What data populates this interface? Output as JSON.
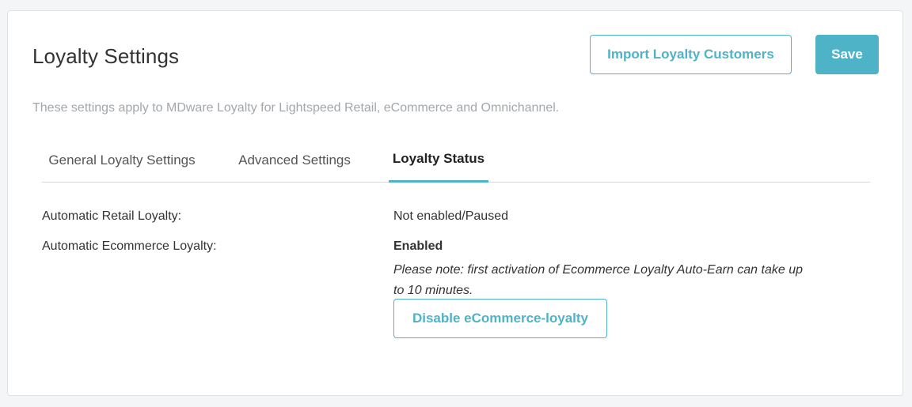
{
  "header": {
    "title": "Loyalty Settings",
    "import_label": "Import Loyalty Customers",
    "save_label": "Save"
  },
  "subtitle": "These settings apply to MDware Loyalty for Lightspeed Retail, eCommerce and Omnichannel.",
  "tabs": [
    {
      "label": "General Loyalty Settings",
      "active": false
    },
    {
      "label": "Advanced Settings",
      "active": false
    },
    {
      "label": "Loyalty Status",
      "active": true
    }
  ],
  "status": {
    "retail": {
      "label": "Automatic Retail Loyalty:",
      "value": "Not enabled/Paused"
    },
    "ecommerce": {
      "label": "Automatic Ecommerce Loyalty:",
      "value": "Enabled",
      "note": "Please note: first activation of Ecommerce Loyalty Auto-Earn can take up to 10 minutes.",
      "disable_label": "Disable eCommerce-loyalty"
    }
  },
  "colors": {
    "accent": "#4fb3c8",
    "background": "#f4f5f6",
    "card": "#ffffff",
    "muted_text": "#a3a7ab"
  }
}
